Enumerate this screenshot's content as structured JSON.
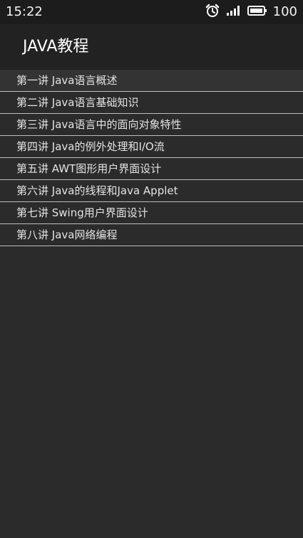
{
  "status_bar": {
    "time": "15:22",
    "icons": [
      "alarm-icon",
      "signal-icon",
      "battery-icon"
    ],
    "battery": "100"
  },
  "app_bar": {
    "title": "JAVA教程"
  },
  "lessons": [
    "第一讲 Java语言概述",
    "第二讲 Java语言基础知识",
    "第三讲 Java语言中的面向对象特性",
    "第四讲 Java的例外处理和I/O流",
    "第五讲 AWT图形用户界面设计",
    "第六讲 Java的线程和Java Applet",
    "第七讲 Swing用户界面设计",
    "第八讲 Java网络编程"
  ]
}
